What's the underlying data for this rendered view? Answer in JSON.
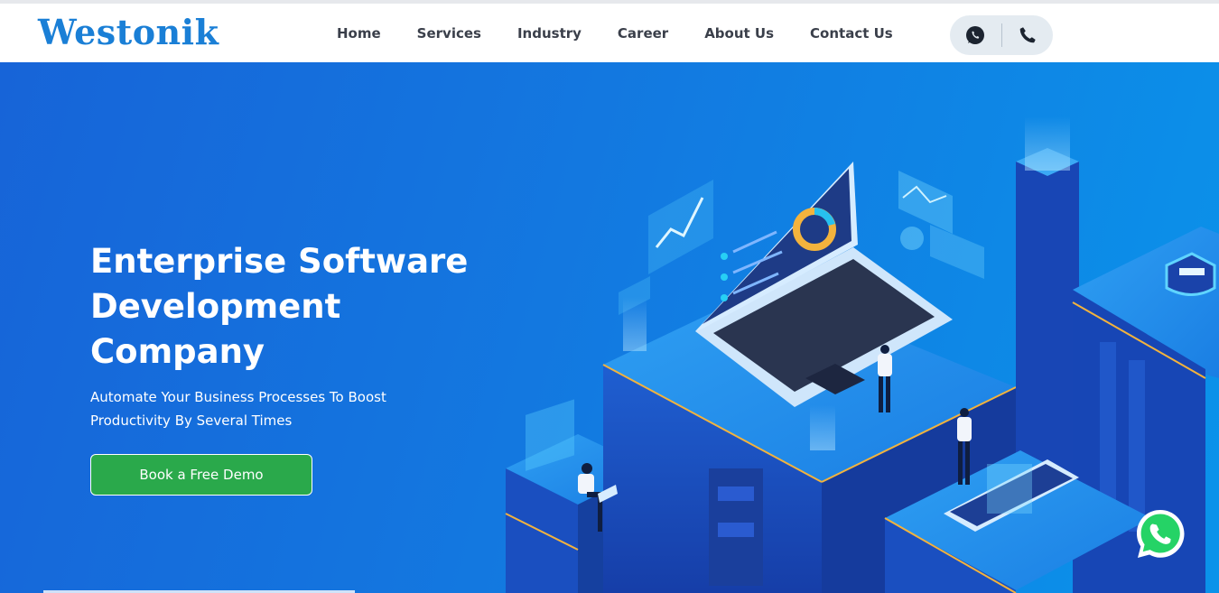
{
  "brand": {
    "logo_text": "Westonik",
    "color": "#1a7fd6"
  },
  "nav": {
    "items": [
      {
        "label": "Home"
      },
      {
        "label": "Services"
      },
      {
        "label": "Industry"
      },
      {
        "label": "Career"
      },
      {
        "label": "About Us"
      },
      {
        "label": "Contact Us"
      }
    ]
  },
  "contact_pill": {
    "icons": [
      "whatsapp-icon",
      "phone-icon"
    ]
  },
  "hero": {
    "title_lines": [
      "Enterprise Software",
      "Development",
      "Company"
    ],
    "subtitle": "Automate Your Business Processes To Boost Productivity By Several Times",
    "cta_label": "Book a Free Demo",
    "cta_color": "#2aa94b"
  },
  "floating": {
    "icon": "whatsapp-icon",
    "color": "#25d366"
  }
}
